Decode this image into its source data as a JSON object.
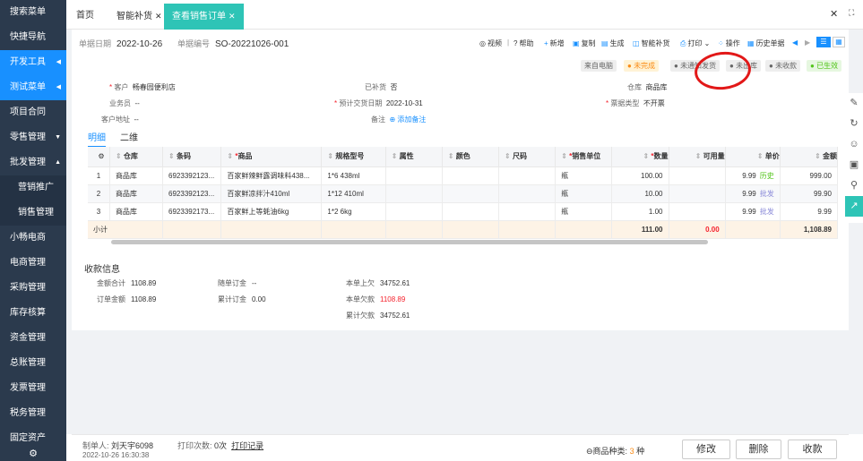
{
  "sidebar": {
    "items": [
      {
        "label": "搜索菜单",
        "active": false
      },
      {
        "label": "快捷导航",
        "active": false
      },
      {
        "label": "开发工具",
        "active": true,
        "arrow": "◀"
      },
      {
        "label": "测试菜单",
        "active": true,
        "arrow": "◀"
      },
      {
        "label": "项目合同",
        "active": false
      },
      {
        "label": "零售管理",
        "active": false,
        "arrow": "▼"
      },
      {
        "label": "批发管理",
        "active": false,
        "arrow": "▲"
      },
      {
        "label": "营销推广",
        "active": false,
        "sub": true
      },
      {
        "label": "销售管理",
        "active": false,
        "sub": true
      },
      {
        "label": "小畅电商",
        "active": false
      },
      {
        "label": "电商管理",
        "active": false
      },
      {
        "label": "采购管理",
        "active": false
      },
      {
        "label": "库存核算",
        "active": false
      },
      {
        "label": "资金管理",
        "active": false
      },
      {
        "label": "总账管理",
        "active": false
      },
      {
        "label": "发票管理",
        "active": false
      },
      {
        "label": "税务管理",
        "active": false
      },
      {
        "label": "固定资产",
        "active": false
      }
    ]
  },
  "tabs": [
    {
      "label": "首页",
      "closable": false
    },
    {
      "label": "智能补货",
      "closable": true
    },
    {
      "label": "查看销售订单",
      "closable": true,
      "active": true
    }
  ],
  "header": {
    "date_label": "单据日期",
    "date": "2022-10-26",
    "no_label": "单据编号",
    "no": "SO-20221026-001"
  },
  "toolbar": {
    "video": "视频",
    "help": "帮助",
    "new": "新增",
    "copy": "复制",
    "generate": "生成",
    "smart": "智能补货",
    "print": "打印",
    "operate": "操作",
    "history": "历史单据"
  },
  "badges": [
    {
      "label": "来自电脑"
    },
    {
      "label": "未完成",
      "color": "#fff3d6",
      "fg": "#fa8c16"
    },
    {
      "label": "未通知发货"
    },
    {
      "label": "未出库"
    },
    {
      "label": "未收款"
    },
    {
      "label": "已生效",
      "color": "#e6f7e0",
      "fg": "#52c41a"
    }
  ],
  "fields": {
    "customer_l": "客户",
    "customer": "畅春园便利店",
    "salesman_l": "业务员",
    "salesman": "--",
    "addr_l": "客户地址",
    "addr": "--",
    "refill_l": "已补货",
    "refill": "否",
    "delivery_l": "预计交货日期",
    "delivery": "2022-10-31",
    "note_l": "备注",
    "note": "添加备注",
    "warehouse_l": "仓库",
    "warehouse": "商品库",
    "invoice_l": "票据类型",
    "invoice": "不开票"
  },
  "subtabs": [
    "明细",
    "二维"
  ],
  "columns": [
    "",
    "仓库",
    "条码",
    "商品",
    "规格型号",
    "属性",
    "颜色",
    "尺码",
    "销售单位",
    "数量",
    "可用量",
    "单价",
    "金额"
  ],
  "rows": [
    {
      "n": "1",
      "wh": "商品库",
      "code": "6923392123...",
      "name": "百家鲜辣鲜露调味料438...",
      "spec": "1*6 438ml",
      "unit": "瓶",
      "qty": "100.00",
      "avail": "",
      "price": "9.99",
      "tag": "历史",
      "amt": "999.00",
      "tagcolor": "#52c41a"
    },
    {
      "n": "2",
      "wh": "商品库",
      "code": "6923392123...",
      "name": "百家鲜凉拌汁410ml",
      "spec": "1*12 410ml",
      "unit": "瓶",
      "qty": "10.00",
      "avail": "",
      "price": "9.99",
      "tag": "批发",
      "amt": "99.90",
      "tagcolor": "#8c8cd9"
    },
    {
      "n": "3",
      "wh": "商品库",
      "code": "6923392173...",
      "name": "百家鲜上等蚝油6kg",
      "spec": "1*2 6kg",
      "unit": "瓶",
      "qty": "1.00",
      "avail": "",
      "price": "9.99",
      "tag": "批发",
      "amt": "9.99",
      "tagcolor": "#8c8cd9"
    }
  ],
  "subtotal": {
    "label": "小计",
    "qty": "111.00",
    "avail": "0.00",
    "amt": "1,108.89"
  },
  "payment": {
    "title": "收款信息",
    "total_l": "金额合计",
    "total": "1108.89",
    "order_l": "订单金额",
    "order": "1108.89",
    "deposit_l": "随单订金",
    "deposit": "--",
    "cum_l": "累计订金",
    "cum": "0.00",
    "prev_l": "本单上欠",
    "prev": "34752.61",
    "owe_l": "本单欠款",
    "owe": "1108.89",
    "total_owe_l": "累计欠款",
    "total_owe": "34752.61"
  },
  "footer": {
    "maker_l": "制单人:",
    "maker": "刘天宇6098",
    "time": "2022-10-26 16:30:38",
    "print_l": "打印次数:",
    "print_n": "0次",
    "print_rec": "打印记录",
    "kinds_l": "商品种类:",
    "kinds": "3",
    "kinds_u": "种",
    "edit": "修改",
    "delete": "删除",
    "receive": "收款"
  }
}
